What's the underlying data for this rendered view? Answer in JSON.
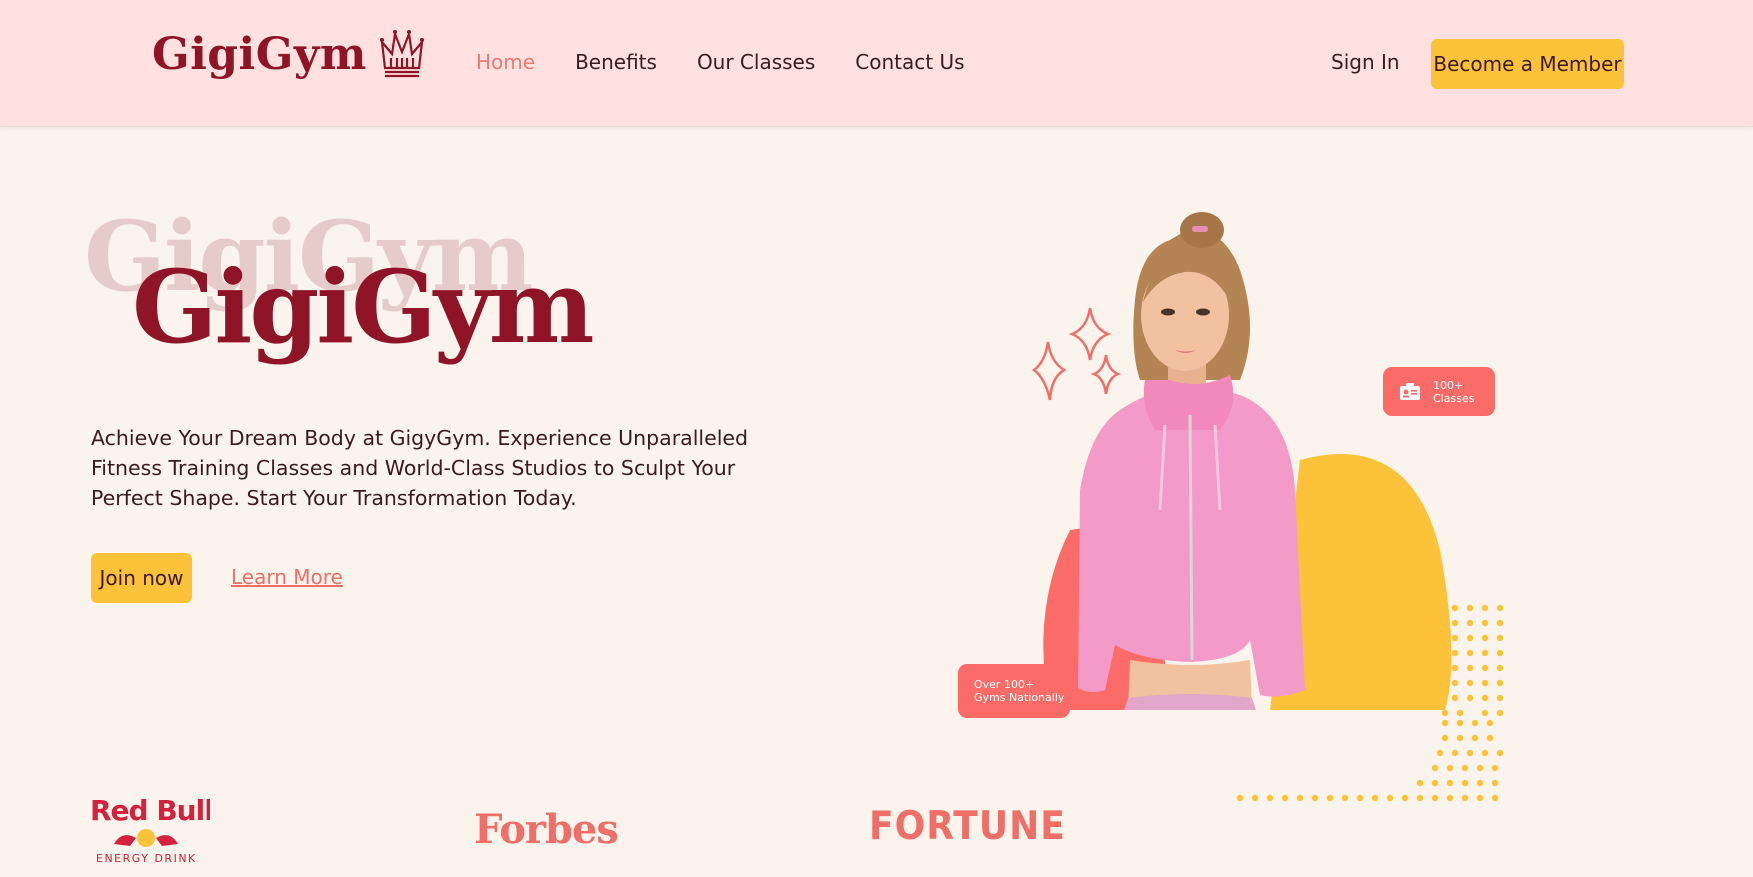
{
  "nav": {
    "logo": "GigiGym",
    "links": [
      {
        "label": "Home",
        "active": true
      },
      {
        "label": "Benefits",
        "active": false
      },
      {
        "label": "Our Classes",
        "active": false
      },
      {
        "label": "Contact Us",
        "active": false
      }
    ],
    "sign_in": "Sign In",
    "cta": "Become a Member"
  },
  "hero": {
    "ghost_title": "GigiGym",
    "title": "GigiGym",
    "description": "Achieve Your Dream Body at GigyGym. Experience Unparalleled Fitness Training Classes and World-Class Studios to Sculpt Your Perfect Shape. Start Your Transformation Today.",
    "join_label": "Join now",
    "learn_label": "Learn More"
  },
  "badges": {
    "classes": {
      "line1": "100+",
      "line2": "Classes",
      "icon": "id-card-icon"
    },
    "gyms": {
      "line1": "Over 100+",
      "line2": "Gyms Nationally"
    }
  },
  "sponsors": {
    "redbull": {
      "name": "Red Bull",
      "tagline": "ENERGY DRINK"
    },
    "forbes": "Forbes",
    "fortune": "FORTUNE"
  },
  "colors": {
    "nav_bg": "#ffe1df",
    "page_bg": "#faf4ec",
    "brand_maroon": "#8f1428",
    "accent_coral": "#ef6f68",
    "accent_yellow": "#fcc23a",
    "badge_coral": "#fb6b67"
  }
}
